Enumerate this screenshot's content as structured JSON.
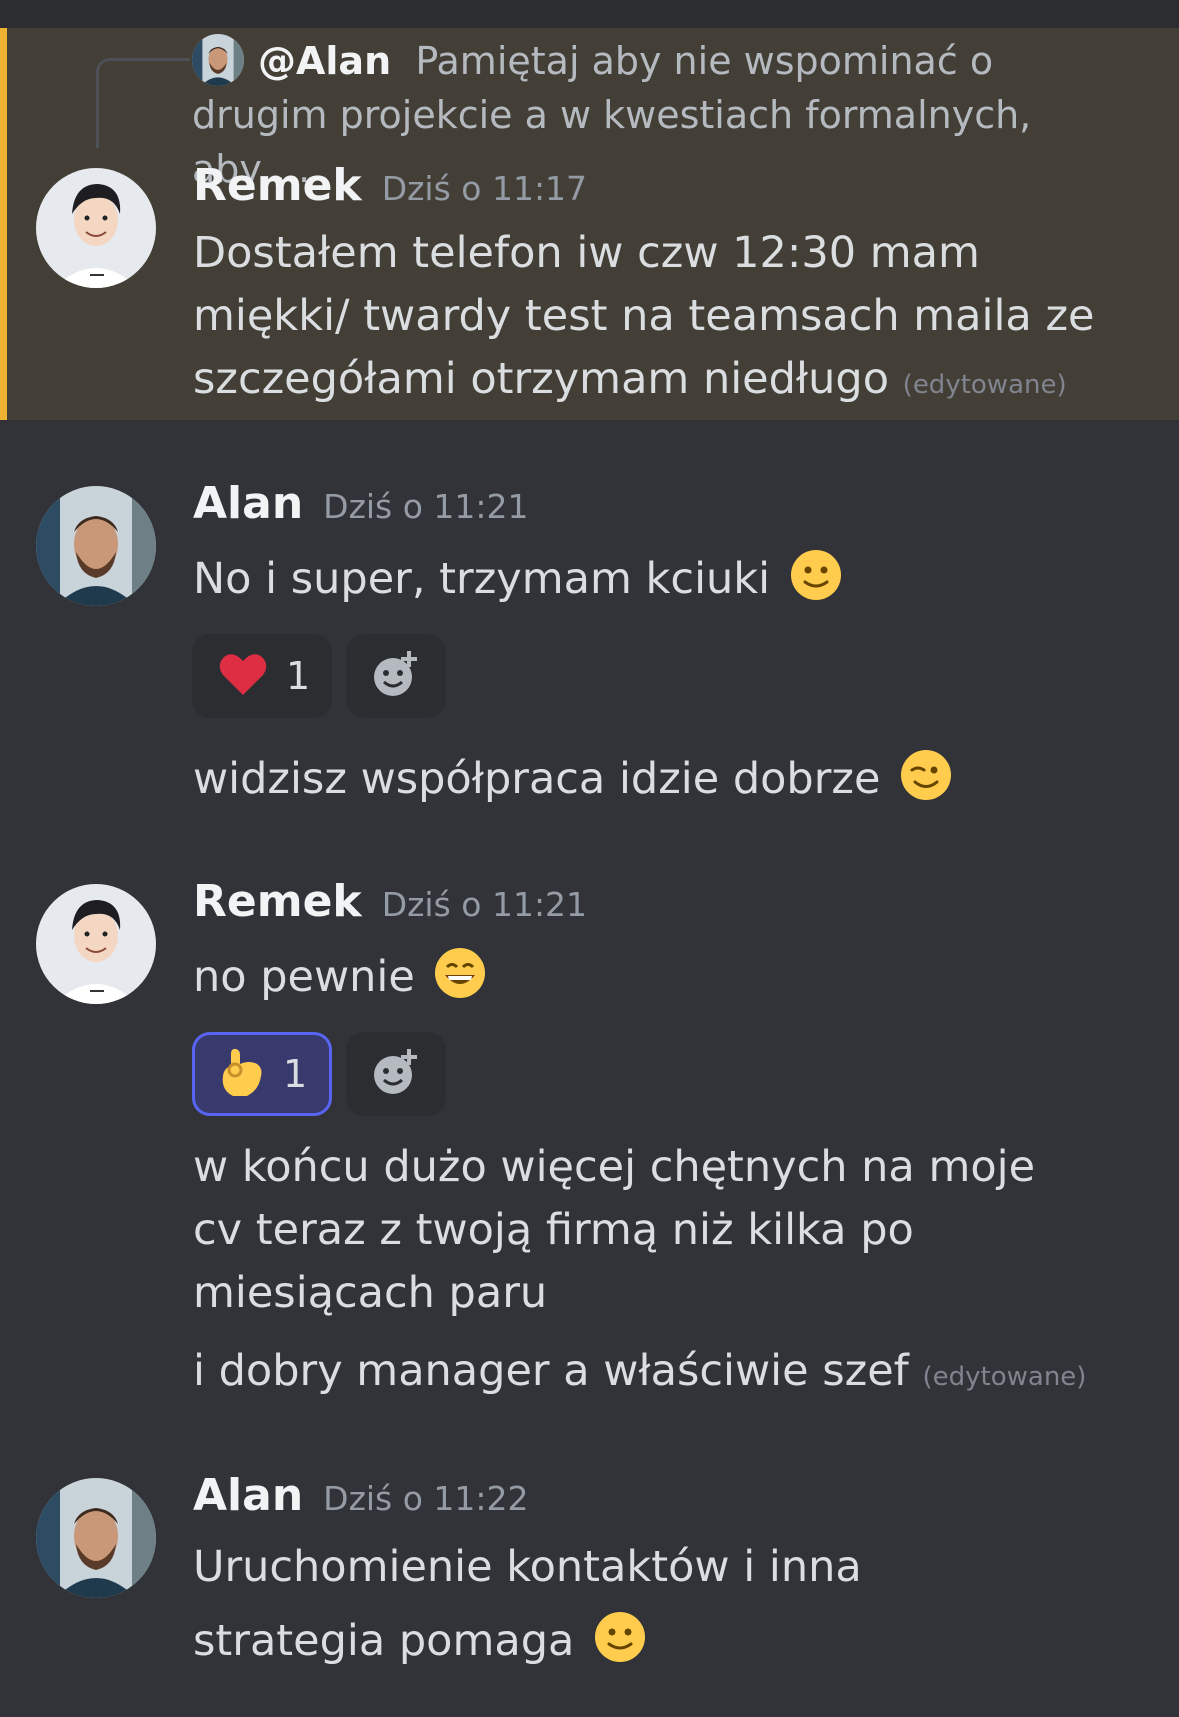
{
  "reply_preview": {
    "author": "@Alan",
    "text": "Pamiętaj aby nie wspominać o drugim projekcie a w kwestiach formalnych, aby ..."
  },
  "messages": [
    {
      "author": "Remek",
      "timestamp": "Dziś o 11:17",
      "avatar": "remek-avatar",
      "text": "Dostałem telefon iw czw 12:30 mam miękki/ twardy test na teamsach maila ze szczegółami otrzymam niedługo",
      "edited": "(edytowane)"
    },
    {
      "author": "Alan",
      "timestamp": "Dziś o 11:21",
      "avatar": "alan-avatar",
      "text": "No i super, trzymam kciuki",
      "emoji": "slightly-smiling-face",
      "reaction": {
        "emoji": "heart",
        "count": "1"
      },
      "followup": "widzisz współpraca idzie dobrze",
      "followup_emoji": "winking-face"
    },
    {
      "author": "Remek",
      "timestamp": "Dziś o 11:21",
      "avatar": "remek-avatar",
      "text": "no pewnie",
      "emoji": "grinning-face",
      "reaction": {
        "emoji": "ok-hand",
        "count": "1"
      },
      "followup": "w końcu dużo więcej chętnych na moje cv teraz z twoją firmą niż kilka po miesiącach paru",
      "followup2": "i dobry manager a właściwie szef",
      "edited": "(edytowane)"
    },
    {
      "author": "Alan",
      "timestamp": "Dziś o 11:22",
      "avatar": "alan-avatar",
      "text": "Uruchomienie kontaktów i inna strategia pomaga",
      "emoji": "slightly-smiling-face"
    }
  ],
  "colors": {
    "background": "#313338",
    "highlight": "#433f36",
    "mention_bar": "#f0b232",
    "reaction_selected": "#5865f2"
  }
}
